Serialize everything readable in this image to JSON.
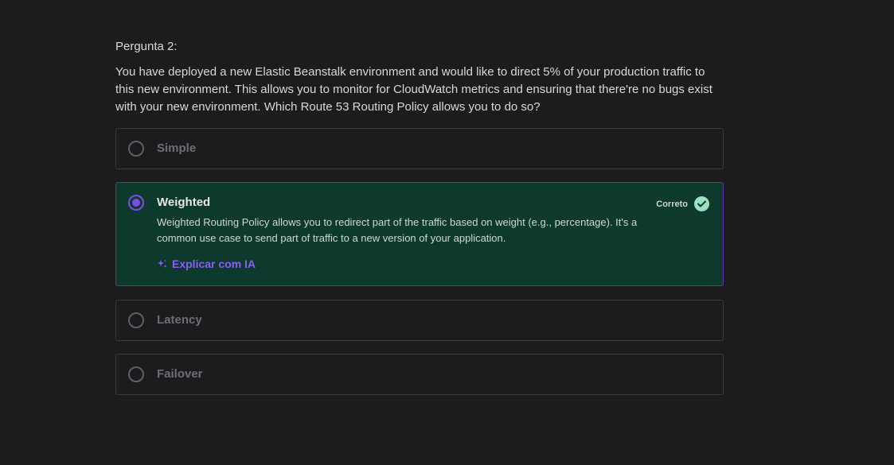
{
  "question": {
    "number_label": "Pergunta 2:",
    "text": "You have deployed a new Elastic Beanstalk environment and would like to direct 5% of your production traffic to this new environment. This allows you to monitor for CloudWatch metrics and ensuring that there're no bugs exist with your new environment. Which Route 53 Routing Policy allows you to do so?"
  },
  "options": [
    {
      "label": "Simple",
      "selected": false
    },
    {
      "label": "Weighted",
      "selected": true,
      "status_label": "Correto",
      "explanation": "Weighted Routing Policy allows you to redirect part of the traffic based on weight (e.g., percentage). It's a common use case to send part of traffic to a new version of your application.",
      "ai_link_label": "Explicar com IA"
    },
    {
      "label": "Latency",
      "selected": false
    },
    {
      "label": "Failover",
      "selected": false
    }
  ],
  "icons": {
    "status": "check-circle-icon",
    "ai": "sparkle-icon"
  },
  "colors": {
    "background": "#1c1c1e",
    "correct_bg": "#0e3a2e",
    "accent": "#7c4ce3",
    "link": "#8b5cf6",
    "check": "#9fe0c2"
  }
}
